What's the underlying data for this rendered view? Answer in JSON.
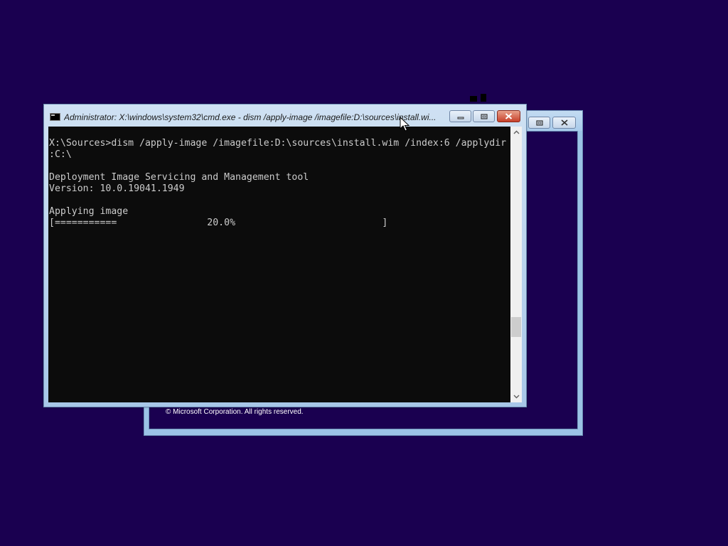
{
  "background_window": {
    "copyright": "© Microsoft Corporation. All rights reserved."
  },
  "cmd_window": {
    "title": "Administrator: X:\\windows\\system32\\cmd.exe - dism  /apply-image /imagefile:D:\\sources\\install.wi...",
    "icon": "cmd-icon",
    "buttons": {
      "minimize": "minimize-icon",
      "maximize": "restore-icon",
      "close": "close-icon"
    },
    "console_text": "X:\\Sources>dism /apply-image /imagefile:D:\\sources\\install.wim /index:6 /applydir\n:C:\\\n\nDeployment Image Servicing and Management tool\nVersion: 10.0.19041.1949\n\nApplying image\n[===========                20.0%                          ]",
    "progress_percent": 20.0
  },
  "colors": {
    "desktop": "#1a0050",
    "console_bg": "#0c0c0c",
    "console_fg": "#cccccc",
    "close_button": "#c7402a"
  }
}
